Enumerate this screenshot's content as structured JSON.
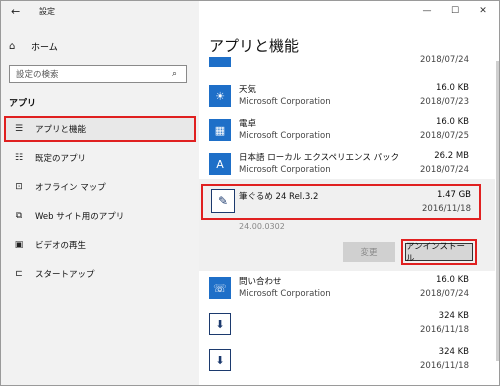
{
  "window": {
    "title": "設定",
    "controls": {
      "minimize": "—",
      "maximize": "☐",
      "close": "✕"
    }
  },
  "sidebar": {
    "home_label": "ホーム",
    "search_placeholder": "設定の検索",
    "section_label": "アプリ",
    "items": [
      {
        "label": "アプリと機能",
        "icon": "apps-features-icon",
        "active": true
      },
      {
        "label": "既定のアプリ",
        "icon": "default-apps-icon",
        "active": false
      },
      {
        "label": "オフライン マップ",
        "icon": "offline-maps-icon",
        "active": false
      },
      {
        "label": "Web サイト用のアプリ",
        "icon": "apps-for-websites-icon",
        "active": false
      },
      {
        "label": "ビデオの再生",
        "icon": "video-playback-icon",
        "active": false
      },
      {
        "label": "スタートアップ",
        "icon": "startup-icon",
        "active": false
      }
    ]
  },
  "main": {
    "title": "アプリと機能",
    "top_date": "2018/07/24",
    "apps": [
      {
        "name": "天気",
        "publisher": "Microsoft Corporation",
        "size": "16.0 KB",
        "date": "2018/07/23",
        "icon": "weather-icon"
      },
      {
        "name": "電卓",
        "publisher": "Microsoft Corporation",
        "size": "16.0 KB",
        "date": "2018/07/25",
        "icon": "calculator-icon"
      },
      {
        "name": "日本語 ローカル エクスペリエンス パック",
        "publisher": "Microsoft Corporation",
        "size": "26.2 MB",
        "date": "2018/07/24",
        "icon": "language-pack-icon"
      }
    ],
    "selected_app": {
      "name": "筆ぐるめ 24 Rel.3.2",
      "size": "1.47 GB",
      "date": "2016/11/18",
      "version": "24.00.0302",
      "change_label": "変更",
      "uninstall_label": "アンインストール"
    },
    "apps_after": [
      {
        "name": "問い合わせ",
        "publisher": "Microsoft Corporation",
        "size": "16.0 KB",
        "date": "2018/07/24",
        "icon": "contact-support-icon"
      },
      {
        "name": "",
        "publisher": "",
        "size": "324 KB",
        "date": "2016/11/18",
        "icon": "installer-icon"
      },
      {
        "name": "",
        "publisher": "",
        "size": "324 KB",
        "date": "2016/11/18",
        "icon": "installer-icon"
      }
    ]
  },
  "colors": {
    "highlight_red": "#e02020",
    "sidebar_bg": "#f2f2f2",
    "app_icon_blue": "#1e6fc8"
  }
}
